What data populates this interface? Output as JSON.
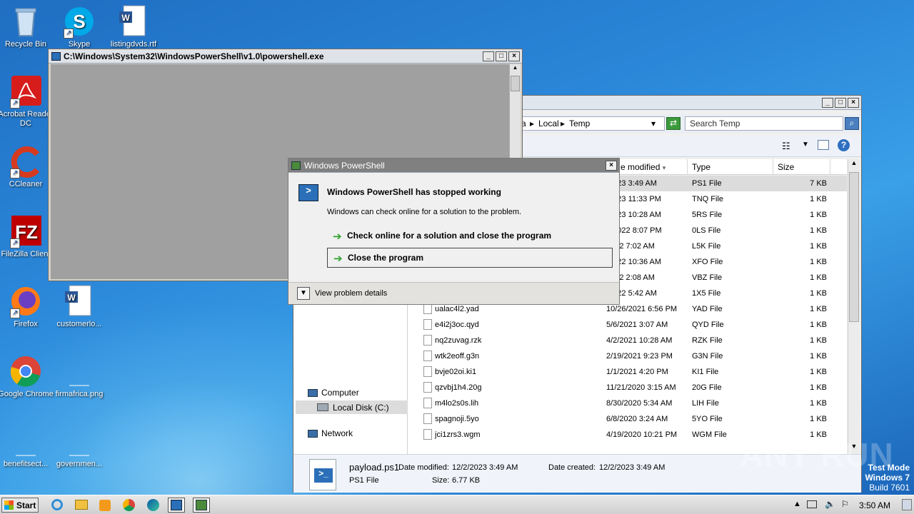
{
  "desktop": {
    "icons": [
      {
        "label": "Recycle Bin"
      },
      {
        "label": "Skype"
      },
      {
        "label": "listingdvds.rtf"
      },
      {
        "label": "Acrobat Reader DC"
      },
      {
        "label": "CCleaner"
      },
      {
        "label": "FileZilla Client"
      },
      {
        "label": "Firefox"
      },
      {
        "label": "customerlo..."
      },
      {
        "label": "Google Chrome"
      },
      {
        "label": "firmafrica.png"
      },
      {
        "label": "benefitsect..."
      },
      {
        "label": "governmen..."
      }
    ],
    "watermark": "ANY RUN",
    "test_mode": [
      "Test Mode",
      "Windows 7",
      "Build 7601"
    ]
  },
  "console": {
    "title": "C:\\Windows\\System32\\WindowsPowerShell\\v1.0\\powershell.exe"
  },
  "explorer": {
    "breadcrumb": [
      "a",
      "Local",
      "Temp"
    ],
    "search_placeholder": "Search Temp",
    "columns": {
      "date": "e modified",
      "type": "Type",
      "size": "Size"
    },
    "nav": {
      "computer": "Computer",
      "local_disk": "Local Disk (C:)",
      "network": "Network"
    },
    "files": [
      {
        "name": "",
        "date": "/2023 3:49 AM",
        "type": "PS1 File",
        "size": "7 KB",
        "selected": true
      },
      {
        "name": "",
        "date": "/2023 11:33 PM",
        "type": "TNQ File",
        "size": "1 KB"
      },
      {
        "name": "",
        "date": "/2023 10:28 AM",
        "type": "5RS File",
        "size": "1 KB"
      },
      {
        "name": "",
        "date": "9/2022 8:07 PM",
        "type": "0LS File",
        "size": "1 KB"
      },
      {
        "name": "",
        "date": "2022 7:02 AM",
        "type": "L5K File",
        "size": "1 KB"
      },
      {
        "name": "",
        "date": "/2022 10:36 AM",
        "type": "XFO File",
        "size": "1 KB"
      },
      {
        "name": "",
        "date": "2022 2:08 AM",
        "type": "VBZ File",
        "size": "1 KB"
      },
      {
        "name": "",
        "date": "/2022 5:42 AM",
        "type": "1X5 File",
        "size": "1 KB"
      },
      {
        "name": "ualac4l2.yad",
        "date": "10/26/2021 6:56 PM",
        "type": "YAD File",
        "size": "1 KB"
      },
      {
        "name": "e4i2j3oc.qyd",
        "date": "5/6/2021 3:07 AM",
        "type": "QYD File",
        "size": "1 KB"
      },
      {
        "name": "nq2zuvag.rzk",
        "date": "4/2/2021 10:28 AM",
        "type": "RZK File",
        "size": "1 KB"
      },
      {
        "name": "wtk2eoff.g3n",
        "date": "2/19/2021 9:23 PM",
        "type": "G3N File",
        "size": "1 KB"
      },
      {
        "name": "bvje02oi.ki1",
        "date": "1/1/2021 4:20 PM",
        "type": "KI1 File",
        "size": "1 KB"
      },
      {
        "name": "qzvbj1h4.20g",
        "date": "11/21/2020 3:15 AM",
        "type": "20G File",
        "size": "1 KB"
      },
      {
        "name": "m4lo2s0s.lih",
        "date": "8/30/2020 5:34 AM",
        "type": "LIH File",
        "size": "1 KB"
      },
      {
        "name": "spagnoji.5yo",
        "date": "6/8/2020 3:24 AM",
        "type": "5YO File",
        "size": "1 KB"
      },
      {
        "name": "jci1zrs3.wgm",
        "date": "4/19/2020 10:21 PM",
        "type": "WGM File",
        "size": "1 KB"
      }
    ],
    "details": {
      "filename": "payload.ps1",
      "filetype": "PS1 File",
      "modified_label": "Date modified:",
      "modified": "12/2/2023 3:49 AM",
      "created_label": "Date created:",
      "created": "12/2/2023 3:49 AM",
      "size_label": "Size:",
      "size": "6.77 KB"
    }
  },
  "dialog": {
    "title": "Windows PowerShell",
    "heading": "Windows PowerShell has stopped working",
    "message": "Windows can check online for a solution to the problem.",
    "option1": "Check online for a solution and close the program",
    "option2": "Close the program",
    "details": "View problem details"
  },
  "taskbar": {
    "start": "Start",
    "clock": "3:50 AM"
  }
}
